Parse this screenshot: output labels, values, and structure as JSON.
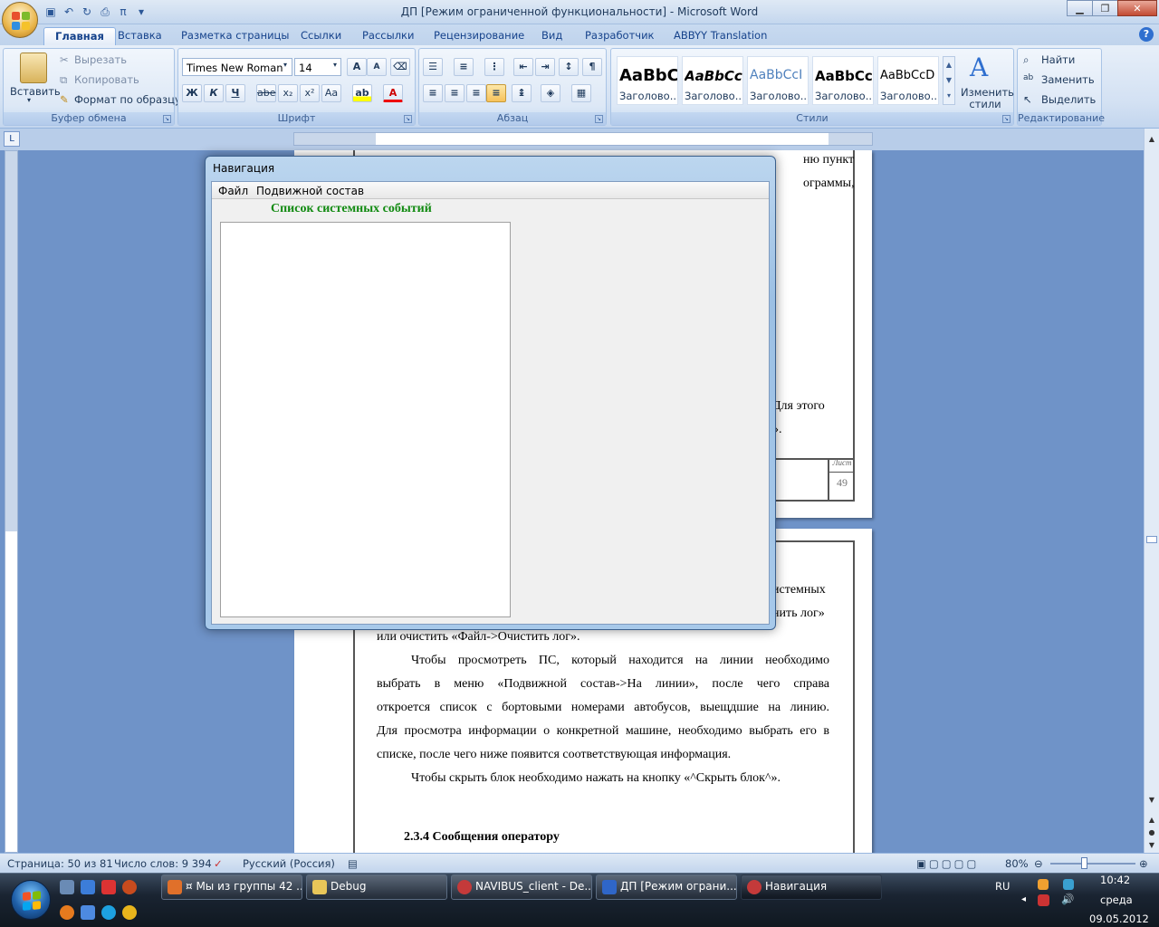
{
  "titlebar": {
    "title": "ДП [Режим ограниченной функциональности] - Microsoft Word",
    "qat_icons": [
      "save-icon",
      "undo-icon",
      "redo-icon",
      "print-icon",
      "pi-icon",
      "customize-icon"
    ]
  },
  "ribbon": {
    "tabs": [
      "Главная",
      "Вставка",
      "Разметка страницы",
      "Ссылки",
      "Рассылки",
      "Рецензирование",
      "Вид",
      "Разработчик",
      "ABBYY Translation"
    ],
    "active_tab": "Главная",
    "clipboard": {
      "paste": "Вставить",
      "cut": "Вырезать",
      "copy": "Копировать",
      "format": "Формат по образцу",
      "label": "Буфер обмена"
    },
    "font": {
      "name": "Times New Roman",
      "size": "14",
      "label": "Шрифт",
      "bold": "Ж",
      "italic": "К",
      "underline": "Ч",
      "strike": "abe",
      "sub": "x₂",
      "sup": "x²",
      "case": "Aa",
      "grow": "A",
      "shrink": "A"
    },
    "paragraph": {
      "label": "Абзац",
      "pilcrow": "¶"
    },
    "styles": {
      "label": "Стили",
      "items": [
        {
          "sample": "AaBbC",
          "name": "Заголово..."
        },
        {
          "sample": "AaBbCc",
          "name": "Заголово..."
        },
        {
          "sample": "AaBbCcI",
          "name": "Заголово..."
        },
        {
          "sample": "AaBbCc",
          "name": "Заголово..."
        },
        {
          "sample": "AaBbCcD",
          "name": "Заголово..."
        }
      ],
      "change": "Изменить стили"
    },
    "editing": {
      "find": "Найти",
      "replace": "Заменить",
      "select": "Выделить",
      "label": "Редактирование"
    }
  },
  "document": {
    "page1_lines": [
      "ню пункт",
      "ограммы,",
      "Для этого",
      "»."
    ],
    "stamp_label": "Лист",
    "stamp_number": "49",
    "page2_lines": {
      "l1": "истемных",
      "l2": "нить лог»",
      "l3": "или очистить «Файл->Очистить лог».",
      "p1": [
        "Чтобы просмотреть ПС, который находится на линии необходимо",
        "выбрать в меню «Подвижной состав->На линии», после чего справа",
        "откроется список с бортовыми номерами автобусов, выещдшие на линию.",
        "Для просмотра информации о конкретной машине, необходимо выбрать его в"
      ],
      "p1_last": "списке, после чего ниже появится соответствующая информация.",
      "p2": "Чтобы скрыть блок необходимо нажать на кнопку «^Скрыть блок^».",
      "heading": "2.3.4 Сообщения оператору"
    }
  },
  "nav_window": {
    "title": "Навигация",
    "menu": [
      "Файл",
      "Подвижной состав"
    ],
    "heading": "Список системных событий"
  },
  "statusbar": {
    "page": "Страница: 50 из 81",
    "words": "Число слов: 9 394",
    "language": "Русский (Россия)",
    "zoom": "80%"
  },
  "taskbar": {
    "buttons": [
      {
        "label": "¤ Мы из группы 42 ...",
        "color": "#e0702a"
      },
      {
        "label": "Debug",
        "color": "#e8c659"
      },
      {
        "label": "NAVIBUS_client - De...",
        "color": "#c43a3a"
      },
      {
        "label": "ДП [Режим ограни...",
        "color": "#2f66c8"
      },
      {
        "label": "Навигация",
        "color": "#c43a3a"
      }
    ],
    "active": "Навигация",
    "lang": "RU",
    "time": "10:42",
    "day": "среда",
    "date": "09.05.2012"
  },
  "colors": {
    "accent": "#15428b",
    "nav_heading": "#118a11",
    "taskbar": "#1a2432"
  }
}
